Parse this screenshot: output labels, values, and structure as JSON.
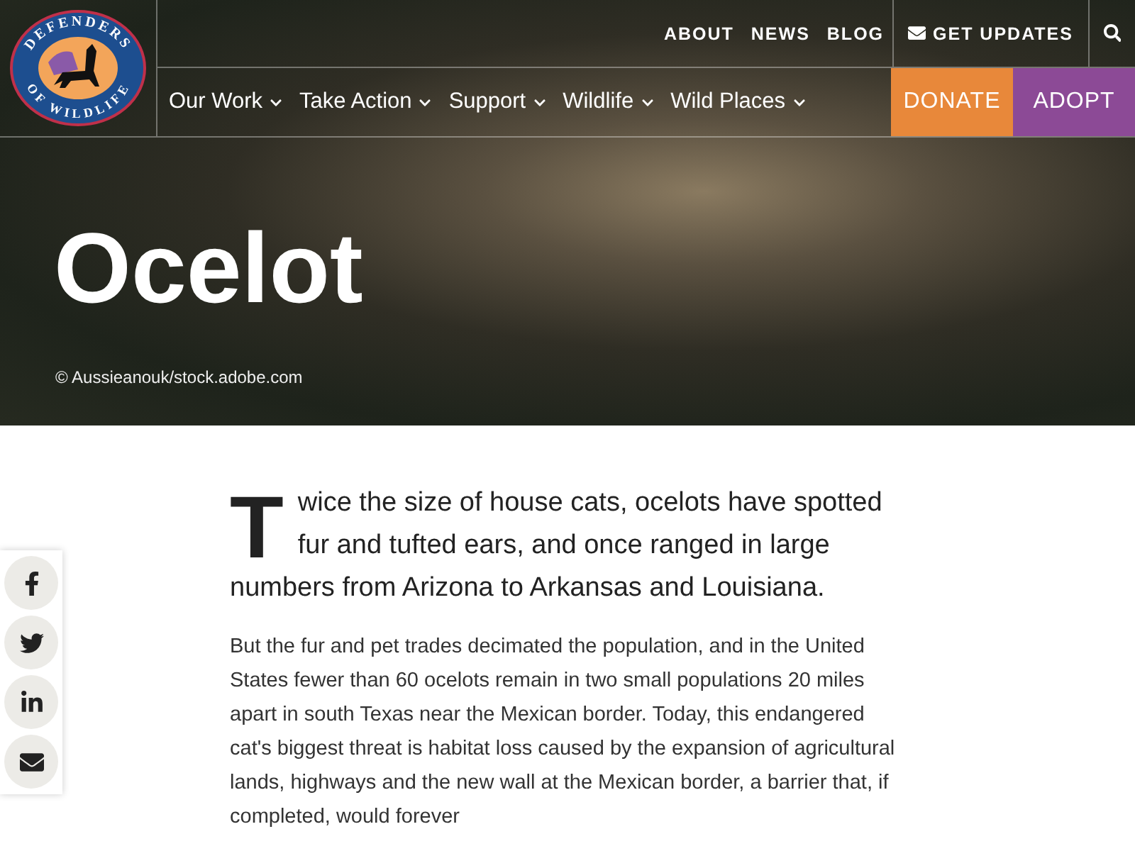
{
  "logo": {
    "top_text": "DEFENDERS",
    "bottom_text": "OF WILDLIFE"
  },
  "utility_nav": [
    {
      "label": "ABOUT",
      "kind": "link"
    },
    {
      "label": "NEWS",
      "kind": "link"
    },
    {
      "label": "BLOG",
      "kind": "link"
    },
    {
      "label": "GET UPDATES",
      "kind": "updates"
    },
    {
      "kind": "search"
    }
  ],
  "main_nav": [
    {
      "label": "Our Work",
      "kind": "menu"
    },
    {
      "label": "Take Action",
      "kind": "menu"
    },
    {
      "label": "Support",
      "kind": "menu"
    },
    {
      "label": "Wildlife",
      "kind": "menu"
    },
    {
      "label": "Wild Places",
      "kind": "menu"
    },
    {
      "label": "DONATE",
      "kind": "donate"
    },
    {
      "label": "ADOPT",
      "kind": "adopt"
    }
  ],
  "hero": {
    "title": "Ocelot",
    "credit": "© Aussieanouk/stock.adobe.com"
  },
  "share": [
    {
      "kind": "facebook"
    },
    {
      "kind": "twitter"
    },
    {
      "kind": "linkedin"
    },
    {
      "kind": "email"
    }
  ],
  "article": {
    "intro": {
      "drop_cap": "T",
      "text": "wice the size of house cats, ocelots have spotted fur and tufted ears, and once ranged in large numbers from Arizona to Arkansas and Louisiana."
    },
    "body": "But the fur and pet trades decimated the population, and in the United States fewer than 60 ocelots remain in two small populations 20 miles apart in south Texas near the Mexican border. Today, this endangered cat's biggest threat is habitat loss caused by the expansion of agricultural lands, highways and the new wall at the Mexican border, a barrier that, if completed, would forever"
  }
}
